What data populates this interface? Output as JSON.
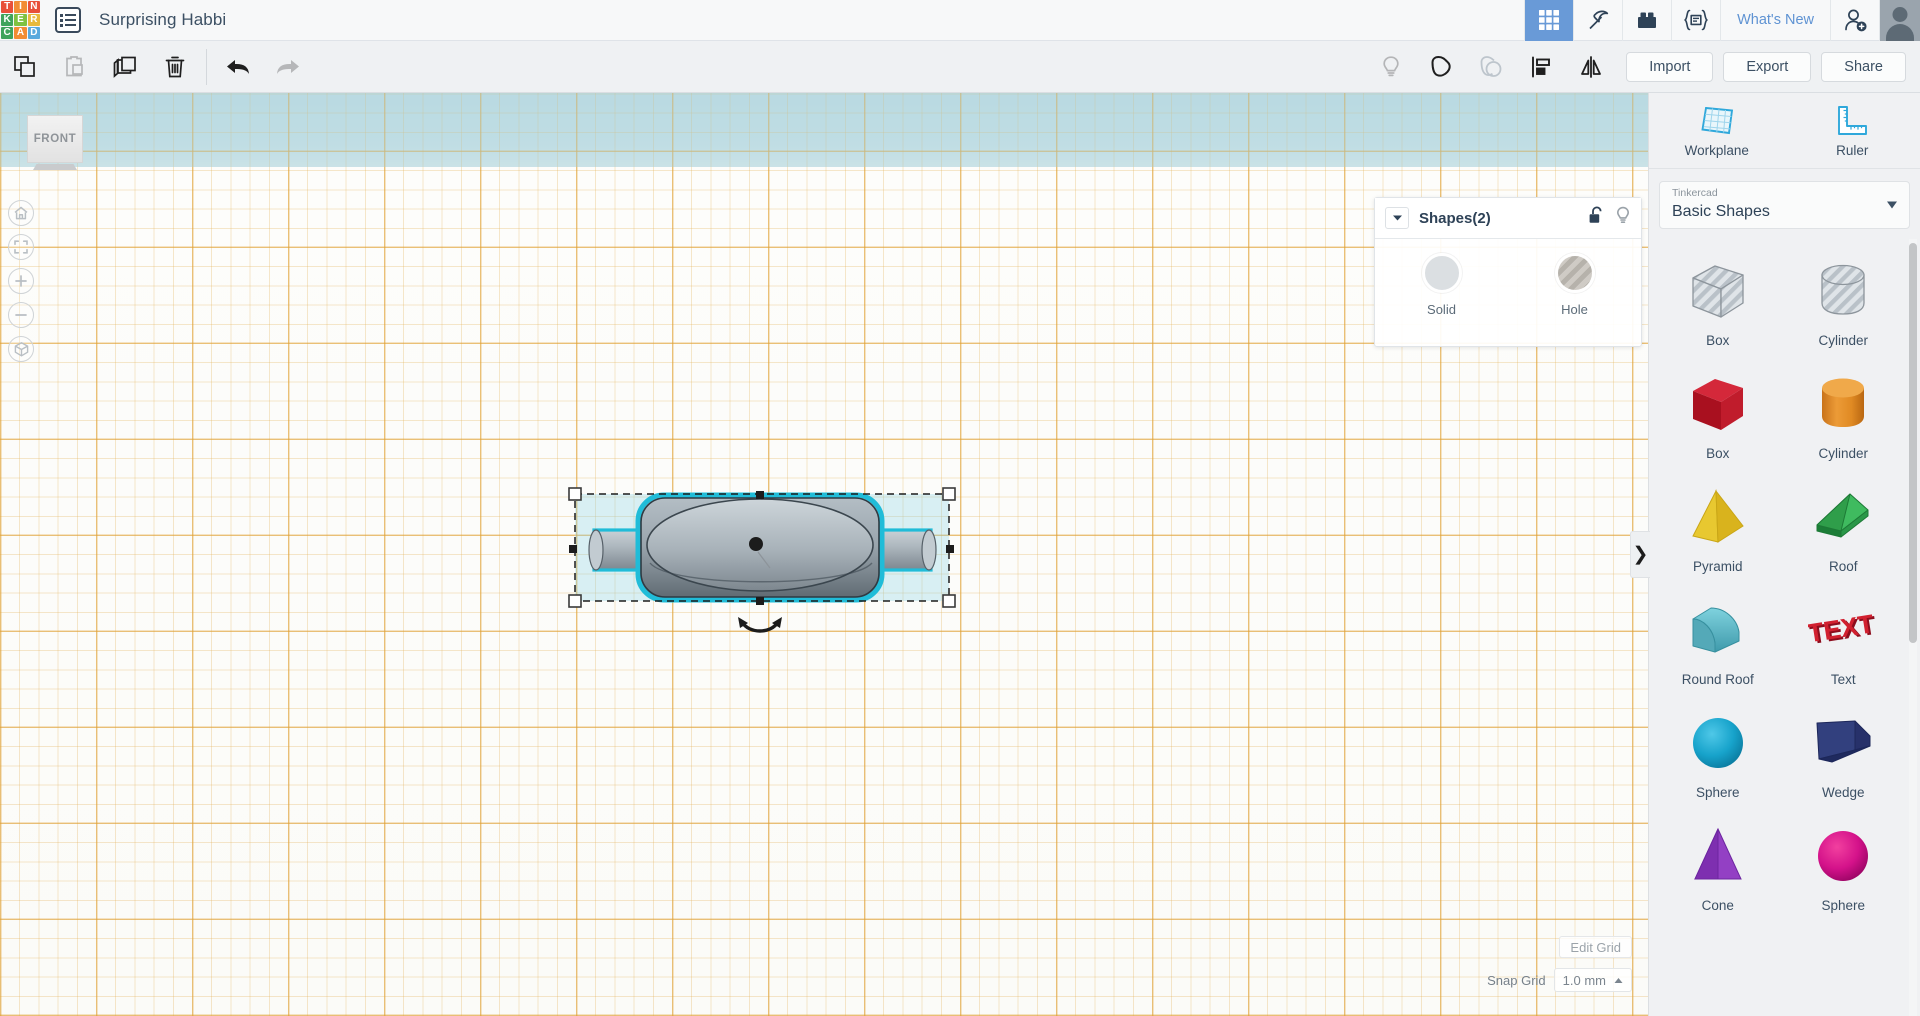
{
  "header": {
    "logo_letters": [
      "T",
      "I",
      "N",
      "K",
      "E",
      "R",
      "C",
      "A",
      "D"
    ],
    "logo_colors": [
      "#e8503a",
      "#f28d35",
      "#e8503a",
      "#3fa35c",
      "#7fc241",
      "#e8b93c",
      "#3fa35c",
      "#f28d35",
      "#59a9dd"
    ],
    "menu_icon": "list-menu-icon",
    "title": "Surprising Habbi",
    "tools": [
      {
        "name": "designs-grid-icon",
        "label": "Designs",
        "active": true
      },
      {
        "name": "pickaxe-icon",
        "label": "Minecraft",
        "active": false
      },
      {
        "name": "lego-brick-icon",
        "label": "Blocks",
        "active": false
      },
      {
        "name": "codeblocks-icon",
        "label": "Codeblocks",
        "active": false
      }
    ],
    "whats_new": "What's New",
    "add_user_icon": "add-user-icon",
    "avatar_icon": "user-avatar"
  },
  "toolbar": {
    "left_buttons": [
      {
        "name": "copy-button",
        "label": "Copy",
        "disabled": false
      },
      {
        "name": "paste-button",
        "label": "Paste",
        "disabled": true
      },
      {
        "name": "duplicate-button",
        "label": "Duplicate",
        "disabled": false
      },
      {
        "name": "delete-button",
        "label": "Delete",
        "disabled": false
      }
    ],
    "history_buttons": [
      {
        "name": "undo-button",
        "label": "Undo",
        "disabled": false
      },
      {
        "name": "redo-button",
        "label": "Redo",
        "disabled": true
      }
    ],
    "right_icon_buttons": [
      {
        "name": "light-bulb-button",
        "label": "Notes",
        "disabled": true
      },
      {
        "name": "group-button",
        "label": "Group",
        "disabled": false
      },
      {
        "name": "ungroup-button",
        "label": "Ungroup",
        "disabled": true
      },
      {
        "name": "align-button",
        "label": "Align",
        "disabled": false
      },
      {
        "name": "mirror-button",
        "label": "Mirror",
        "disabled": false
      }
    ],
    "import_label": "Import",
    "export_label": "Export",
    "share_label": "Share"
  },
  "viewport": {
    "view_cube_face": "FRONT",
    "nav_buttons": [
      {
        "name": "home-view-button",
        "label": "Home view"
      },
      {
        "name": "fit-to-view-button",
        "label": "Fit all in view"
      },
      {
        "name": "zoom-in-button",
        "label": "Zoom in"
      },
      {
        "name": "zoom-out-button",
        "label": "Zoom out"
      },
      {
        "name": "perspective-toggle-button",
        "label": "Switch to orthographic view"
      }
    ],
    "collapse_chevron": "❯",
    "edit_grid_label": "Edit Grid",
    "snap_grid_label": "Snap Grid",
    "snap_grid_value": "1.0 mm",
    "colors": {
      "sky": "#c5dfe5",
      "ground": "#fcfcfa",
      "grid_line": "#e2b056",
      "selection": "#2bbfd9"
    }
  },
  "shapes_popup": {
    "title": "Shapes(2)",
    "lock_icon": "unlocked-padlock-icon",
    "bulb_icon": "light-bulb-icon",
    "caret_icon": "chevron-down-icon",
    "options": [
      {
        "name": "solid-swatch",
        "label": "Solid",
        "type": "solid"
      },
      {
        "name": "hole-swatch",
        "label": "Hole",
        "type": "hole"
      }
    ]
  },
  "right_panel": {
    "workplane_label": "Workplane",
    "ruler_label": "Ruler",
    "library_category": "Tinkercad",
    "library_name": "Basic Shapes",
    "shapes": [
      {
        "name": "Box",
        "kind": "box-hole",
        "color": "#c8ced4"
      },
      {
        "name": "Cylinder",
        "kind": "cylinder-hole",
        "color": "#c8ced4"
      },
      {
        "name": "Box",
        "kind": "box",
        "color": "#c8202f"
      },
      {
        "name": "Cylinder",
        "kind": "cylinder",
        "color": "#e08a23"
      },
      {
        "name": "Pyramid",
        "kind": "pyramid",
        "color": "#e8c322"
      },
      {
        "name": "Roof",
        "kind": "roof",
        "color": "#2ca44b"
      },
      {
        "name": "Round Roof",
        "kind": "round-roof",
        "color": "#52b4c4"
      },
      {
        "name": "Text",
        "kind": "text",
        "color": "#c81f32"
      },
      {
        "name": "Sphere",
        "kind": "sphere",
        "color": "#18a0c8"
      },
      {
        "name": "Wedge",
        "kind": "wedge",
        "color": "#2c3b77"
      },
      {
        "name": "Cone",
        "kind": "cone",
        "color": "#8b36b8"
      },
      {
        "name": "Sphere",
        "kind": "sphere",
        "color": "#d4128a"
      }
    ]
  }
}
